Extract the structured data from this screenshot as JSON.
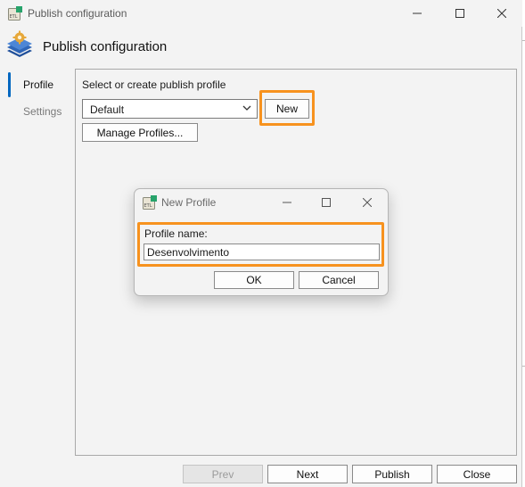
{
  "window": {
    "title": "Publish configuration"
  },
  "header": {
    "title": "Publish configuration"
  },
  "nav": {
    "profile": "Profile",
    "settings": "Settings"
  },
  "profile": {
    "prompt": "Select or create publish profile",
    "selected_profile": "Default",
    "new_button": "New",
    "manage_button": "Manage Profiles..."
  },
  "dialog": {
    "title": "New Profile",
    "label": "Profile name:",
    "value": "Desenvolvimento",
    "ok": "OK",
    "cancel": "Cancel"
  },
  "footer": {
    "prev": "Prev",
    "next": "Next",
    "publish": "Publish",
    "close": "Close"
  },
  "colors": {
    "highlight": "#f7921e",
    "accent": "#0067c0",
    "window_bg": "#f3f3f3"
  },
  "icons": [
    "etl-app-icon",
    "minimize-icon",
    "maximize-icon",
    "close-icon",
    "publish-layers-gear-icon",
    "chevron-down-icon"
  ]
}
